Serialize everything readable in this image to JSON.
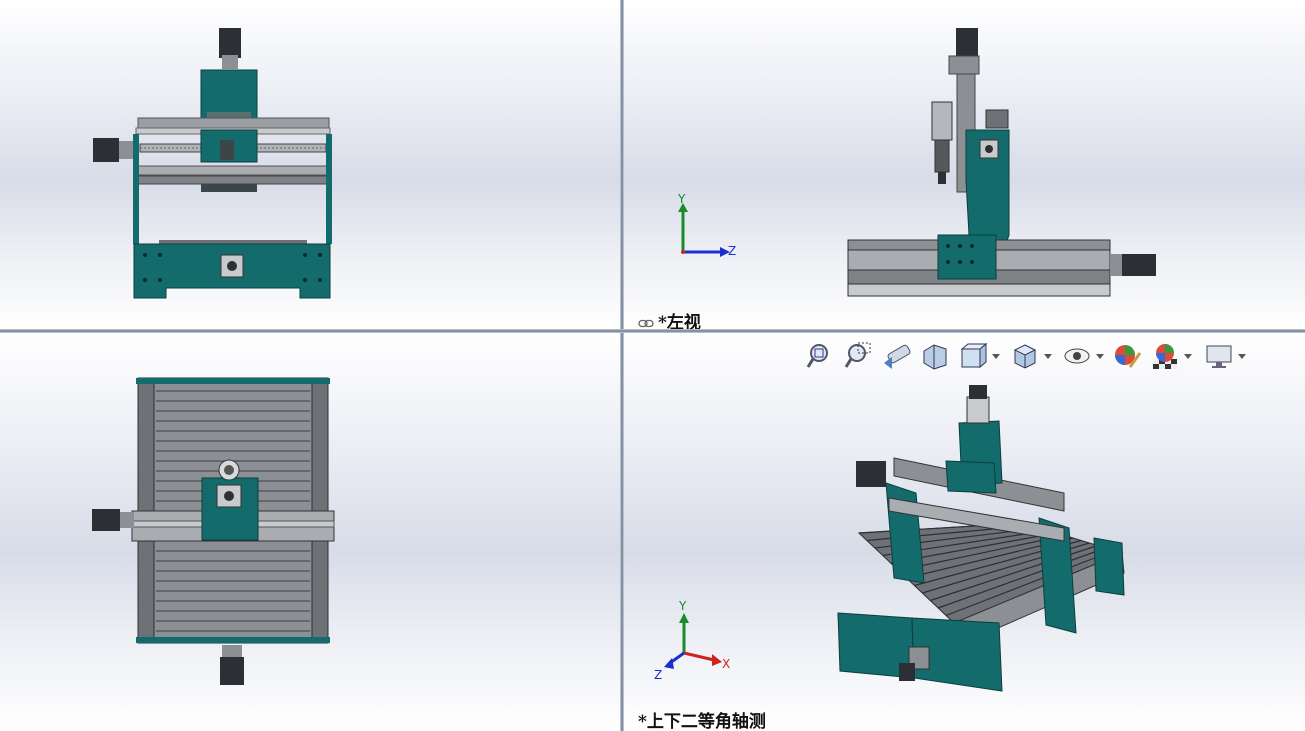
{
  "viewports": {
    "top_left": {
      "name": "front-view"
    },
    "top_right": {
      "name": "left-view",
      "label": "*左视",
      "triad": {
        "y": "Y",
        "z": "Z"
      }
    },
    "bottom_left": {
      "name": "top-view"
    },
    "bottom_right": {
      "name": "isometric-view",
      "label": "*上下二等角轴测",
      "triad": {
        "y": "Y",
        "x": "X",
        "z": "Z"
      }
    }
  },
  "heads_up_toolbar": {
    "items": [
      "zoom-to-fit-icon",
      "zoom-to-area-icon",
      "previous-view-icon",
      "section-view-icon",
      "view-orientation-icon",
      "display-style-icon",
      "hide-show-items-icon",
      "edit-appearance-icon",
      "apply-scene-icon",
      "view-settings-icon"
    ]
  },
  "colors": {
    "frame_teal": "#146b6b",
    "rail_gray": "#8c8f94",
    "dark": "#2c2f33",
    "axis_y": "#1a8a2a",
    "axis_x": "#d02020",
    "axis_z": "#1a2fd0"
  }
}
